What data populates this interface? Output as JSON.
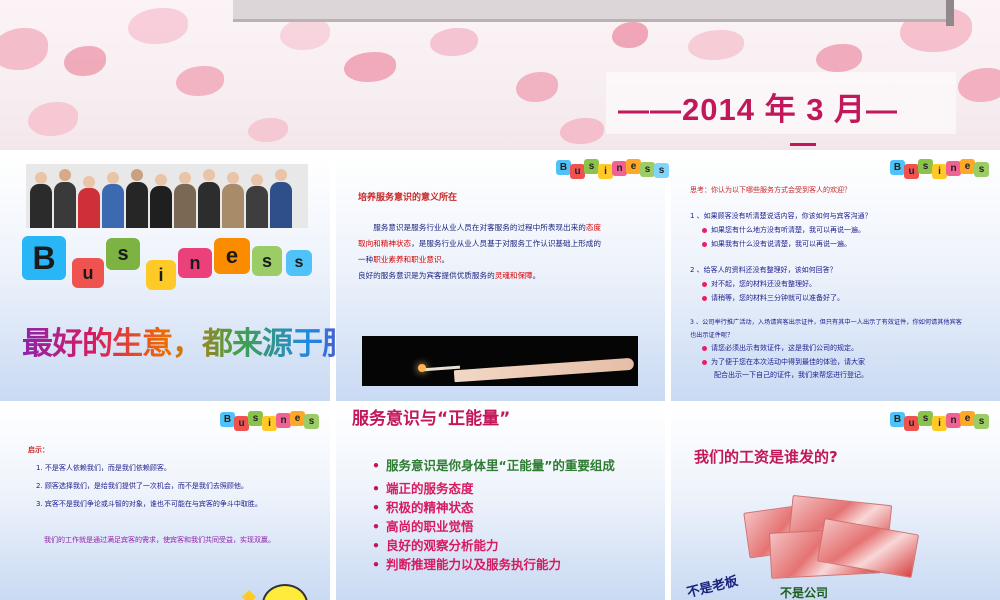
{
  "hero": {
    "date": "——2014 年 3 月—"
  },
  "logo_letters": [
    "B",
    "u",
    "s",
    "i",
    "n",
    "e",
    "s",
    "s"
  ],
  "slide1": {
    "slogan": "最好的生意，都来源于服务"
  },
  "slide2": {
    "title": "培养服务意识的意义所在",
    "p1_a": "服务意识是服务行业从业人员在对客服务的过程中所表现出来的",
    "p1_b": "态度",
    "p1_c": "取向和精神状态",
    "p1_d": "，是服务行业从业人员基于对服务工作认识基础上形成的",
    "p1_e": "一种",
    "p1_f": "职业素养和职业意识",
    "p1_g": "。",
    "p2_a": "良好的服务意识是为宾客提供优质服务的",
    "p2_b": "灵魂和保障",
    "p2_c": "。"
  },
  "slide3": {
    "question": "思考：你认为以下哪些服务方式会受到客人的欢迎？",
    "q1": "1 、如果顾客没有听清楚说话内容，你该如何与宾客沟通？",
    "q1_a": "如果您有什么地方没有听清楚，我可以再说一遍。",
    "q1_b": "如果我有什么没有说清楚，我可以再说一遍。",
    "q2": "2 、给客人的资料还没有整理好，该如何回答？",
    "q2_a": "对不起，您的材料还没有整理好。",
    "q2_b": "请稍等，您的材料三分钟就可以准备好了。",
    "q3": "3 、公司举行推广活动，入场请宾客出示证件，但只有其中一人出示了有效证件，你如何请其他宾客",
    "q3_cont": "也出示证件呢？",
    "q3_a": "请您必须出示有效证件，这是我们公司的规定。",
    "q3_b": "为了便于您在本次活动中得到最佳的体验，请大家",
    "q3_b2": "配合出示一下自己的证件，我们来帮您进行登记。"
  },
  "slide5": {
    "title": "启示：",
    "i1": "1. 不是客人依赖我们，而是我们依赖顾客。",
    "i2": "2. 顾客选择我们，是给我们提供了一次机会，而不是我们去照顾他。",
    "i3": "3. 宾客不是我们争论或斗智的对象，谁也不可能在与宾客的争斗中取胜。",
    "summary": "我们的工作就是通过满足宾客的需求，使宾客和我们共同受益，实现双赢。"
  },
  "slide6": {
    "heading": "服务意识与“正能量”",
    "items": [
      "服务意识是你身体里“正能量”的重要组成",
      "端正的服务态度",
      "积极的精神状态",
      "高尚的职业觉悟",
      "良好的观察分析能力",
      "判断推理能力以及服务执行能力"
    ]
  },
  "slide7": {
    "heading": "我们的工资是谁发的?",
    "t1": "不是老板",
    "t2": "不是公司"
  }
}
